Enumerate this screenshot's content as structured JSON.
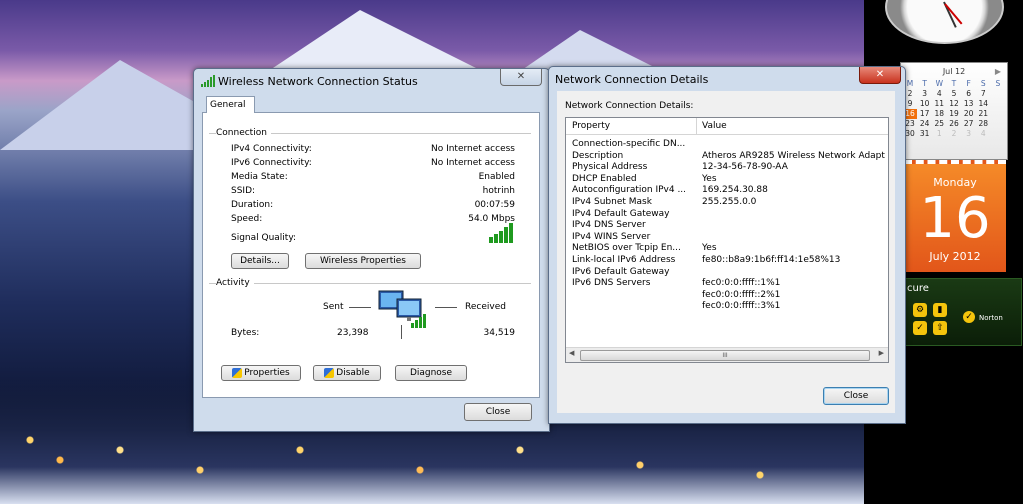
{
  "status_window": {
    "title": "Wireless Network Connection Status",
    "close_glyph": "✕",
    "tab": "General",
    "connection_label": "Connection",
    "fields": [
      {
        "label": "IPv4 Connectivity:",
        "value": "No Internet access"
      },
      {
        "label": "IPv6 Connectivity:",
        "value": "No Internet access"
      },
      {
        "label": "Media State:",
        "value": "Enabled"
      },
      {
        "label": "SSID:",
        "value": "hotrinh"
      },
      {
        "label": "Duration:",
        "value": "00:07:59"
      },
      {
        "label": "Speed:",
        "value": "54.0 Mbps"
      }
    ],
    "signal_quality_label": "Signal Quality:",
    "details_button": "Details...",
    "wireless_properties_button": "Wireless Properties",
    "activity_label": "Activity",
    "sent_label": "Sent",
    "received_label": "Received",
    "bytes_label": "Bytes:",
    "bytes_sent": "23,398",
    "bytes_received": "34,519",
    "properties_button": "Properties",
    "disable_button": "Disable",
    "diagnose_button": "Diagnose",
    "close_button": "Close"
  },
  "details_window": {
    "title": "Network Connection Details",
    "close_glyph": "✕",
    "group_label": "Network Connection Details:",
    "col_property": "Property",
    "col_value": "Value",
    "rows": [
      {
        "p": "Connection-specific DN...",
        "v": ""
      },
      {
        "p": "Description",
        "v": "Atheros AR9285 Wireless Network Adapt"
      },
      {
        "p": "Physical Address",
        "v": "12-34-56-78-90-AA"
      },
      {
        "p": "DHCP Enabled",
        "v": "Yes"
      },
      {
        "p": "Autoconfiguration IPv4 ...",
        "v": "169.254.30.88"
      },
      {
        "p": "IPv4 Subnet Mask",
        "v": "255.255.0.0"
      },
      {
        "p": "IPv4 Default Gateway",
        "v": ""
      },
      {
        "p": "IPv4 DNS Server",
        "v": ""
      },
      {
        "p": "IPv4 WINS Server",
        "v": ""
      },
      {
        "p": "NetBIOS over Tcpip En...",
        "v": "Yes"
      },
      {
        "p": "Link-local IPv6 Address",
        "v": "fe80::b8a9:1b6f:ff14:1e58%13"
      },
      {
        "p": "IPv6 Default Gateway",
        "v": ""
      },
      {
        "p": "IPv6 DNS Servers",
        "v": "fec0:0:0:ffff::1%1"
      },
      {
        "p": "",
        "v": "fec0:0:0:ffff::2%1"
      },
      {
        "p": "",
        "v": "fec0:0:0:ffff::3%1"
      }
    ],
    "scroll_left": "◀",
    "scroll_thumb": "III",
    "scroll_right": "▶",
    "close_button": "Close"
  },
  "gadgets": {
    "calendar_month": {
      "header": "Jul 12",
      "next_arrow": "▶",
      "weekdays": [
        "M",
        "T",
        "W",
        "T",
        "F",
        "S",
        "S"
      ],
      "weeks": [
        [
          "2",
          "3",
          "4",
          "5",
          "6",
          "7",
          ""
        ],
        [
          "9",
          "10",
          "11",
          "12",
          "13",
          "14",
          ""
        ],
        [
          "16",
          "17",
          "18",
          "19",
          "20",
          "21",
          ""
        ],
        [
          "23",
          "24",
          "25",
          "26",
          "27",
          "28",
          ""
        ],
        [
          "30",
          "31",
          "1",
          "2",
          "3",
          "4",
          ""
        ]
      ]
    },
    "calendar_day": {
      "weekday": "Monday",
      "day": "16",
      "month_year": "July 2012"
    },
    "norton": {
      "title": "cure",
      "brand": "Norton"
    }
  }
}
